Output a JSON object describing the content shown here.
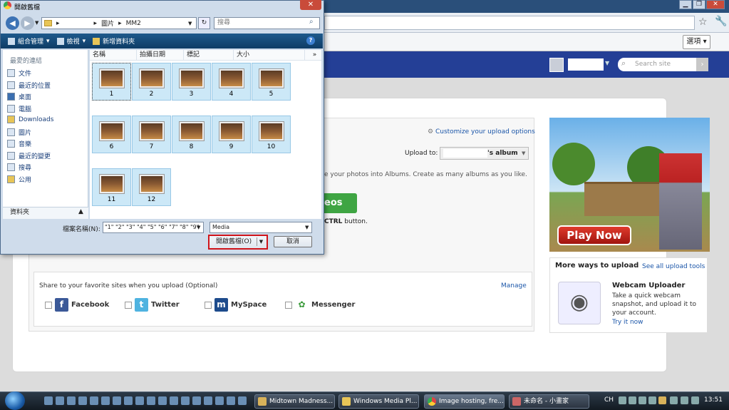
{
  "browser": {
    "options_label": "選項",
    "window_min": "▁",
    "window_max": "❐",
    "window_close": "✕"
  },
  "site": {
    "search_placeholder": "Search site",
    "customize_link": "Customize your upload options",
    "upload_to_label": "Upload to:",
    "album_suffix": "'s album",
    "albums_text": "e your photos into Albums. Create as many albums as you like.",
    "upload_button": "eos",
    "ctrl_text_pre": "",
    "ctrl_key": "CTRL",
    "ctrl_text_post": " button.",
    "share_title": "Share to your favorite sites when you upload (Optional)",
    "manage_link": "Manage",
    "share_sites": [
      "Facebook",
      "Twitter",
      "MySpace",
      "Messenger"
    ],
    "ad_play_now": "Play Now",
    "more_ways_title": "More ways to upload",
    "see_all_link": "See all upload tools",
    "webcam_title": "Webcam Uploader",
    "webcam_desc": "Take a quick webcam snapshot, and upload it to your account.",
    "try_now": "Try it now"
  },
  "dialog": {
    "title": "開啟舊檔",
    "breadcrumb": [
      "圖片",
      "MM2"
    ],
    "search_placeholder": "搜尋",
    "commands": [
      "組合管理",
      "檢視",
      "新增資料夾"
    ],
    "favorites_header": "最愛的連結",
    "nav_items": [
      "文件",
      "最近的位置",
      "桌面",
      "電腦",
      "Downloads",
      "圖片",
      "音樂",
      "最近的變更",
      "搜尋",
      "公用"
    ],
    "folders_label": "資料夾",
    "columns": [
      "名稱",
      "拍攝日期",
      "標記",
      "大小"
    ],
    "columns_more": "»",
    "files": [
      "1",
      "2",
      "3",
      "4",
      "5",
      "6",
      "7",
      "8",
      "9",
      "10",
      "11",
      "12"
    ],
    "filename_label": "檔案名稱(N):",
    "filename_value": "\"1\" \"2\" \"3\" \"4\" \"5\" \"6\" \"7\" \"8\" \"9\"",
    "filter_value": "Media",
    "open_button": "開啟舊檔(O)",
    "cancel_button": "取消"
  },
  "taskbar": {
    "tasks": [
      "Midtown Madness...",
      "Windows Media Pl...",
      "Image hosting, fre...",
      "未命名 - 小畫家"
    ],
    "lang": "CH",
    "clock": "13:51"
  },
  "colors": {
    "site_header": "#243f96",
    "upload_green": "#3fa543",
    "link_blue": "#1a55a8",
    "highlight_red": "#d0141a"
  }
}
